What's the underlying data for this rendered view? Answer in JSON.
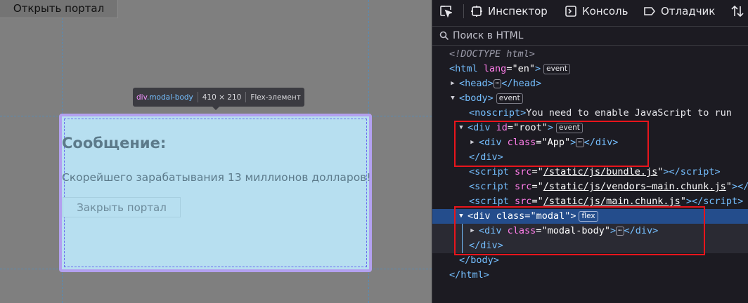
{
  "page": {
    "open_button": "Открыть портал",
    "modal": {
      "title": "Сообщение:",
      "text": "Скорейшего зарабатывания 13 миллионов долларов!",
      "close_button": "Закрыть портал"
    },
    "tooltip": {
      "tag": "div",
      "class": ".modal-body",
      "size": "410 × 210",
      "type": "Flex-элемент"
    }
  },
  "devtools": {
    "tabs": [
      {
        "label": "Инспектор",
        "icon": "inspector-icon"
      },
      {
        "label": "Консоль",
        "icon": "console-icon"
      },
      {
        "label": "Отладчик",
        "icon": "debugger-icon"
      }
    ],
    "search_placeholder": "Поиск в HTML",
    "tree": {
      "doctype": "<!DOCTYPE html>",
      "html_open": "html",
      "lang_attr": "lang",
      "lang_val": "\"en\"",
      "event_badge": "event",
      "flex_badge": "flex",
      "head": "head",
      "body": "body",
      "noscript_text": "You need to enable JavaScript to run",
      "root_id_val": "\"root\"",
      "app_class_val": "\"App\"",
      "script1_src": "/static/js/bundle.js",
      "script2_src": "/static/js/vendors~main.chunk.js",
      "script3_src": "/static/js/main.chunk.js",
      "modal_class_val": "\"modal\"",
      "modal_body_class_val": "\"modal-body\""
    }
  },
  "colors": {
    "accent": "#75bfff",
    "selection": "#244d8c",
    "highlight_box": "#e8151c",
    "modal_bg": "#b7dff0"
  }
}
